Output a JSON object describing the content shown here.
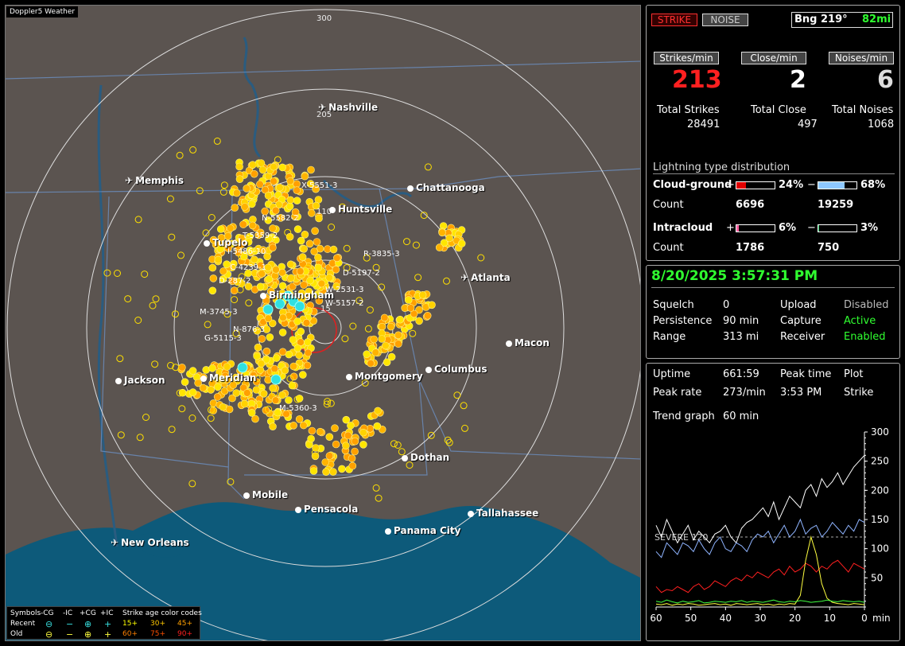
{
  "map": {
    "title": "Doppler5 Weather",
    "rings": [
      "300",
      "205",
      "110",
      "15"
    ],
    "cities": [
      {
        "name": "Nashville",
        "kind": "air"
      },
      {
        "name": "Memphis",
        "kind": "air"
      },
      {
        "name": "Chattanooga",
        "kind": "city"
      },
      {
        "name": "Huntsville",
        "kind": "city"
      },
      {
        "name": "Tupelo",
        "kind": "city"
      },
      {
        "name": "Birmingham",
        "kind": "city"
      },
      {
        "name": "Atlanta",
        "kind": "air"
      },
      {
        "name": "Macon",
        "kind": "city"
      },
      {
        "name": "Jackson",
        "kind": "city"
      },
      {
        "name": "Meridian",
        "kind": "city"
      },
      {
        "name": "Montgomery",
        "kind": "city"
      },
      {
        "name": "Columbus",
        "kind": "city"
      },
      {
        "name": "Dothan",
        "kind": "city"
      },
      {
        "name": "Mobile",
        "kind": "city"
      },
      {
        "name": "Pensacola",
        "kind": "city"
      },
      {
        "name": "Tallahassee",
        "kind": "city"
      },
      {
        "name": "Panama City",
        "kind": "city"
      },
      {
        "name": "New Orleans",
        "kind": "air"
      }
    ],
    "tracks": [
      "X-5551-3",
      "R-3835-3",
      "D-5197-2",
      "W-2531-3",
      "W-5157-2",
      "M-3745-3",
      "N-876-3",
      "G-5115-3",
      "M-5360-3",
      "I-5486-10",
      "C-4239-1",
      "D-287-2",
      "T-5359-2",
      "N-5582-2"
    ],
    "legend": {
      "symbols_label": "Symbols",
      "cols": [
        "-CG",
        "-IC",
        "+CG",
        "+IC"
      ],
      "age_label": "Strike age color codes",
      "recent_label": "Recent",
      "old_label": "Old",
      "recent_ages": [
        "15+",
        "30+",
        "45+"
      ],
      "old_ages": [
        "60+",
        "75+",
        "90+"
      ],
      "sym_minus_cg": "⊖",
      "sym_minus_ic": "−",
      "sym_plus_cg": "⊕",
      "sym_plus_ic": "+"
    }
  },
  "status": {
    "strike_btn": "STRIKE",
    "noise_btn": "NOISE",
    "bearing": "Bng 219°",
    "distance": "82mi",
    "strikes_min_label": "Strikes/min",
    "close_min_label": "Close/min",
    "noises_min_label": "Noises/min",
    "strikes_min": "213",
    "close_min": "2",
    "noises_min": "6",
    "total_strikes_label": "Total Strikes",
    "total_close_label": "Total Close",
    "total_noises_label": "Total Noises",
    "total_strikes": "28491",
    "total_close": "497",
    "total_noises": "1068"
  },
  "distribution": {
    "title": "Lightning type distribution",
    "cg_label": "Cloud-ground",
    "ic_label": "Intracloud",
    "count_label": "Count",
    "plus": "+",
    "minus": "−",
    "cg_plus_pct": "24%",
    "cg_minus_pct": "68%",
    "cg_plus_count": "6696",
    "cg_minus_count": "19259",
    "ic_plus_pct": "6%",
    "ic_minus_pct": "3%",
    "ic_plus_count": "1786",
    "ic_minus_count": "750",
    "cg_plus_frac": 0.24,
    "cg_minus_frac": 0.68,
    "ic_plus_frac": 0.06,
    "ic_minus_frac": 0.03
  },
  "settings": {
    "datetime": "8/20/2025 3:57:31 PM",
    "squelch_label": "Squelch",
    "squelch": "0",
    "persistence_label": "Persistence",
    "persistence": "90 min",
    "range_label": "Range",
    "range": "313 mi",
    "upload_label": "Upload",
    "upload": "Disabled",
    "capture_label": "Capture",
    "capture": "Active",
    "receiver_label": "Receiver",
    "receiver": "Enabled"
  },
  "stats": {
    "uptime_label": "Uptime",
    "uptime": "661:59",
    "peak_time_label": "Peak time",
    "peak_time": "3:53 PM",
    "plot_label": "Plot",
    "plot": "Strike",
    "peak_rate_label": "Peak rate",
    "peak_rate": "273/min",
    "trend_label": "Trend graph",
    "trend": "60 min"
  },
  "chart_data": {
    "type": "line",
    "x_label": "min",
    "x_ticks": [
      60,
      50,
      40,
      30,
      20,
      10,
      0
    ],
    "y_ticks": [
      300,
      250,
      200,
      150,
      100,
      50
    ],
    "ylim": [
      0,
      300
    ],
    "threshold_label": "SEVERE 120",
    "threshold": 120,
    "series": [
      {
        "color": "#ffffff",
        "values": [
          140,
          120,
          150,
          130,
          110,
          125,
          140,
          115,
          130,
          120,
          110,
          125,
          130,
          140,
          120,
          110,
          135,
          145,
          150,
          160,
          170,
          155,
          180,
          150,
          170,
          190,
          180,
          170,
          200,
          210,
          190,
          220,
          205,
          215,
          230,
          210,
          225,
          240,
          250,
          260
        ]
      },
      {
        "color": "#8fb4ff",
        "values": [
          95,
          85,
          110,
          100,
          90,
          110,
          105,
          95,
          115,
          100,
          90,
          110,
          120,
          100,
          95,
          110,
          105,
          95,
          115,
          125,
          120,
          130,
          110,
          125,
          140,
          120,
          130,
          150,
          125,
          135,
          140,
          120,
          130,
          145,
          135,
          125,
          140,
          130,
          150,
          145
        ]
      },
      {
        "color": "#ff2020",
        "values": [
          35,
          25,
          30,
          28,
          35,
          30,
          25,
          35,
          40,
          30,
          35,
          45,
          40,
          35,
          45,
          50,
          45,
          55,
          50,
          60,
          55,
          50,
          60,
          65,
          55,
          70,
          60,
          65,
          75,
          70,
          60,
          70,
          65,
          75,
          80,
          70,
          60,
          75,
          70,
          65
        ]
      },
      {
        "color": "#ffff40",
        "values": [
          5,
          4,
          6,
          3,
          5,
          4,
          6,
          5,
          3,
          4,
          5,
          6,
          4,
          5,
          3,
          6,
          5,
          4,
          5,
          6,
          4,
          5,
          3,
          5,
          4,
          6,
          5,
          20,
          80,
          120,
          90,
          40,
          15,
          8,
          6,
          5,
          4,
          6,
          5,
          4
        ]
      },
      {
        "color": "#40ff40",
        "values": [
          10,
          8,
          12,
          9,
          7,
          10,
          8,
          9,
          11,
          7,
          8,
          10,
          9,
          8,
          10,
          9,
          11,
          8,
          10,
          9,
          8,
          10,
          12,
          9,
          8,
          10,
          9,
          11,
          10,
          8,
          9,
          10,
          12,
          10,
          9,
          11,
          10,
          9,
          10,
          8
        ]
      }
    ]
  }
}
